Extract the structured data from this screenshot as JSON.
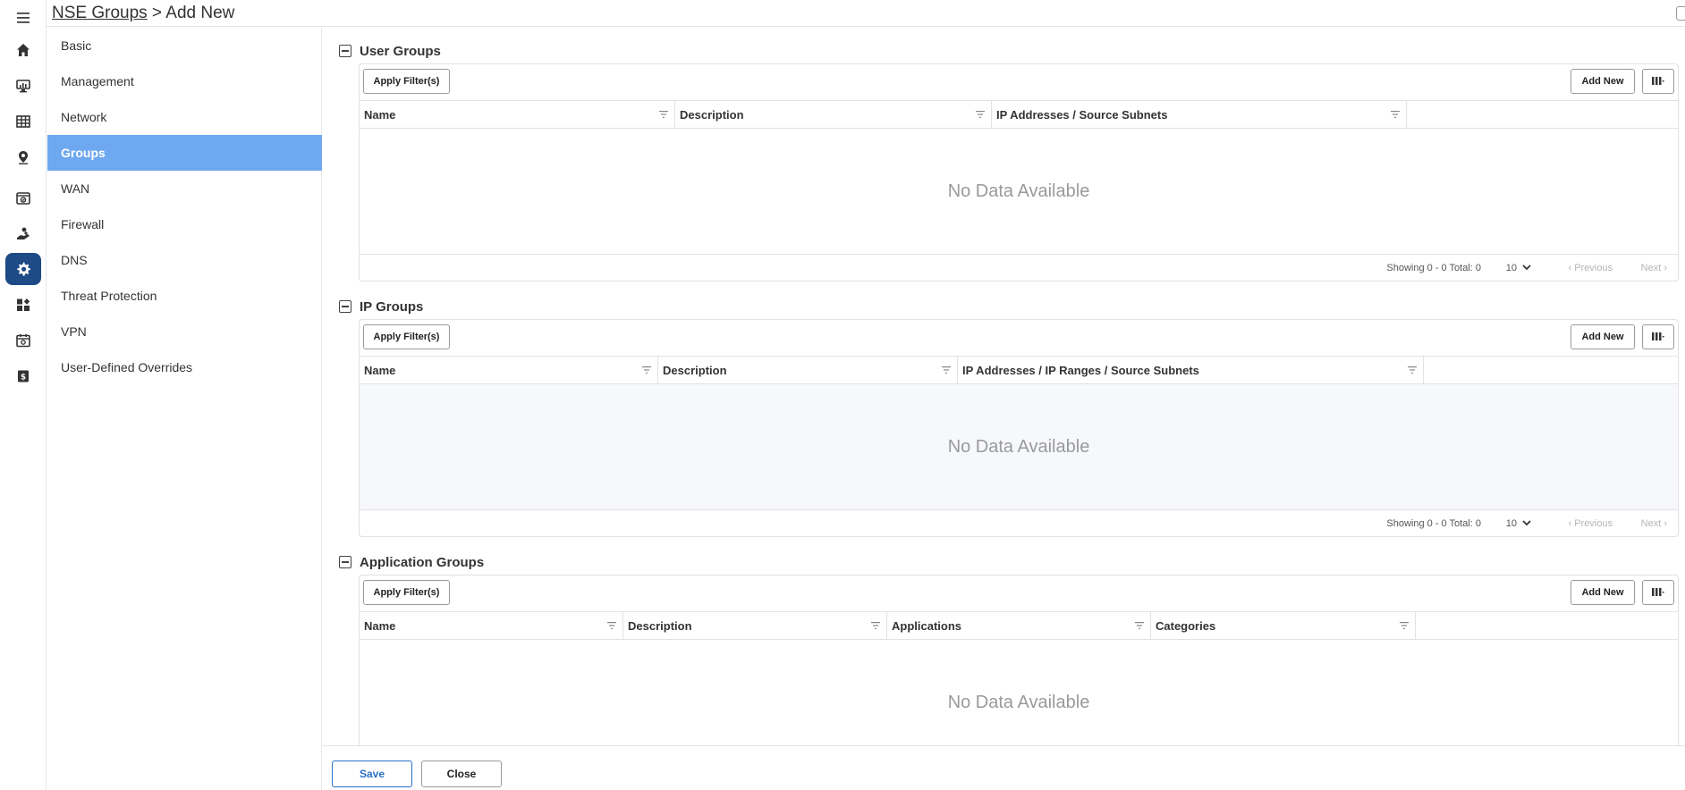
{
  "breadcrumb": {
    "parent": "NSE Groups",
    "separator": " > ",
    "current": "Add New"
  },
  "rail": {
    "icons": [
      "menu-icon",
      "home-icon",
      "monitor-icon",
      "table-icon",
      "location-pin-icon",
      "status-window-icon",
      "support-icon",
      "settings-gear-icon",
      "dashboard-widgets-icon",
      "calendar-icon",
      "billing-icon"
    ],
    "active": "settings-gear-icon"
  },
  "nav": {
    "items": [
      {
        "label": "Basic"
      },
      {
        "label": "Management"
      },
      {
        "label": "Network"
      },
      {
        "label": "Groups",
        "active": true
      },
      {
        "label": "WAN"
      },
      {
        "label": "Firewall"
      },
      {
        "label": "DNS"
      },
      {
        "label": "Threat Protection"
      },
      {
        "label": "VPN"
      },
      {
        "label": "User-Defined Overrides"
      }
    ]
  },
  "sections": {
    "user_groups": {
      "title": "User Groups",
      "apply_label": "Apply Filter(s)",
      "add_label": "Add New",
      "columns": [
        "Name",
        "Description",
        "IP Addresses / Source Subnets"
      ],
      "empty_text": "No Data Available",
      "pager": {
        "showing": "Showing 0 - 0 Total: 0",
        "page_size": "10",
        "prev": "‹  Previous",
        "next": "Next  ›"
      }
    },
    "ip_groups": {
      "title": "IP Groups",
      "apply_label": "Apply Filter(s)",
      "add_label": "Add New",
      "columns": [
        "Name",
        "Description",
        "IP Addresses / IP Ranges / Source Subnets"
      ],
      "empty_text": "No Data Available",
      "pager": {
        "showing": "Showing 0 - 0 Total: 0",
        "page_size": "10",
        "prev": "‹  Previous",
        "next": "Next  ›"
      }
    },
    "application_groups": {
      "title": "Application Groups",
      "apply_label": "Apply Filter(s)",
      "add_label": "Add New",
      "columns": [
        "Name",
        "Description",
        "Applications",
        "Categories"
      ],
      "empty_text": "No Data Available"
    }
  },
  "footer": {
    "save_label": "Save",
    "close_label": "Close"
  },
  "colors": {
    "rail_active": "#1e4a86",
    "nav_active": "#6ea8f0",
    "save_accent": "#2a6fc4"
  }
}
